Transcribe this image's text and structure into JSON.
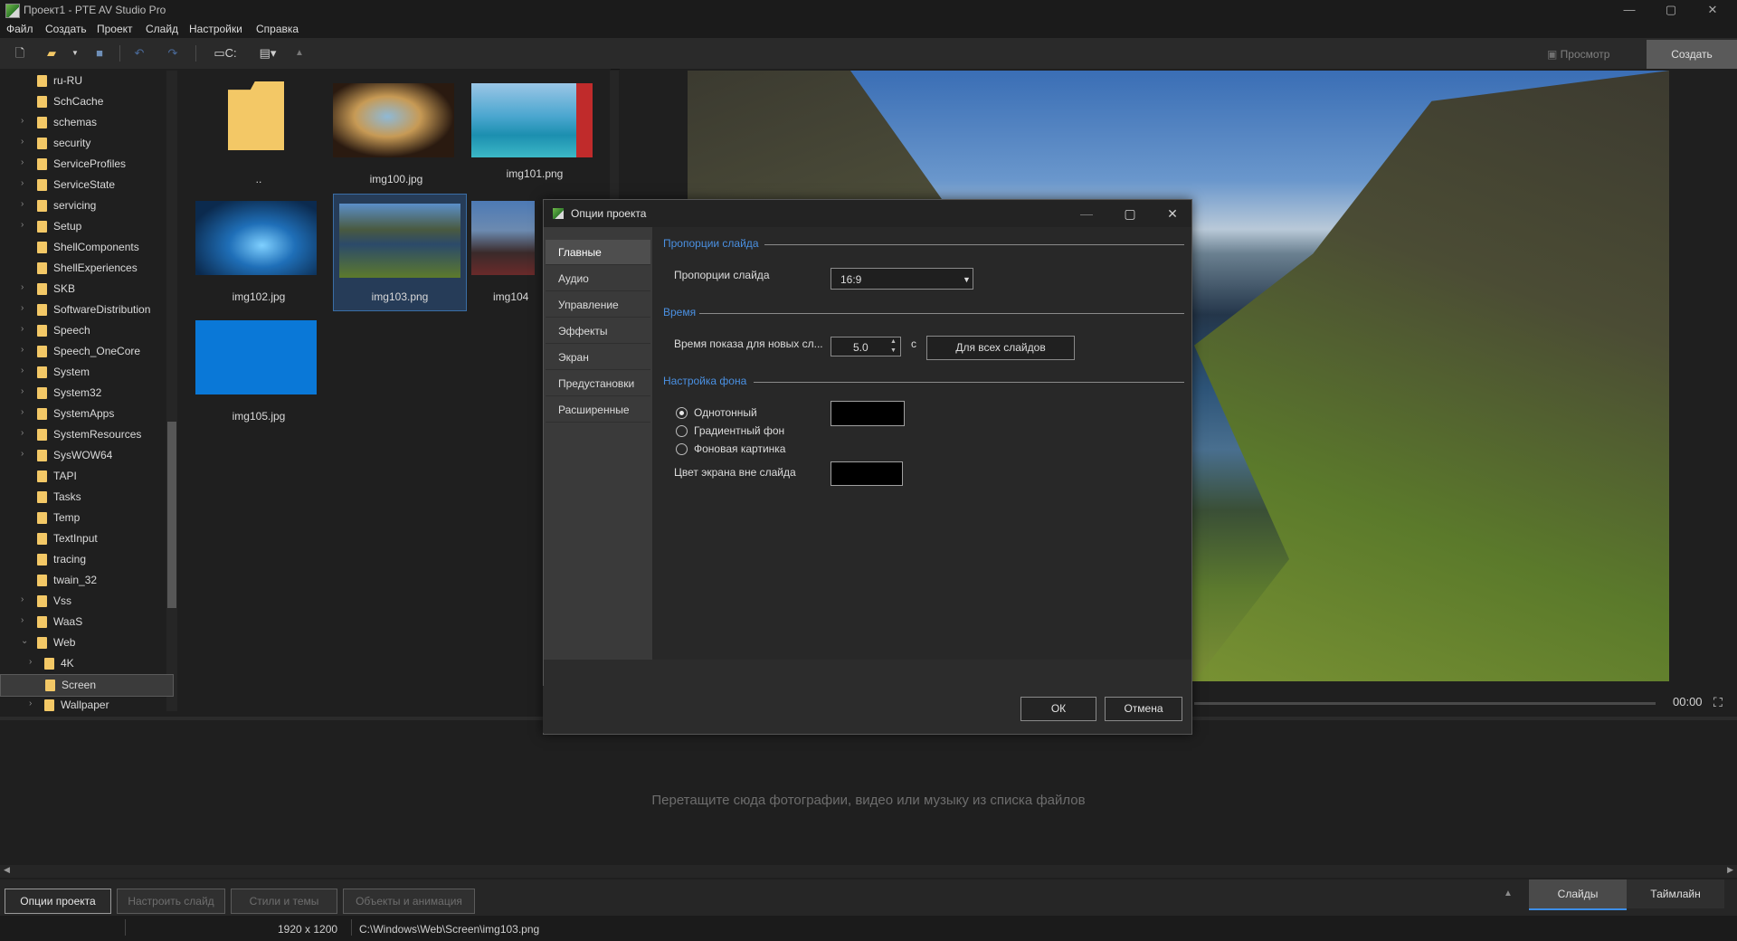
{
  "window": {
    "title": "Проект1 - PTE AV Studio Pro",
    "minimize": "—",
    "maximize": "▢",
    "close": "✕"
  },
  "menu": [
    "Файл",
    "Создать",
    "Проект",
    "Слайд",
    "Настройки",
    "Справка"
  ],
  "toolbar": {
    "drive_label": "C:",
    "preview_label": "Просмотр",
    "create_label": "Создать"
  },
  "tree": [
    {
      "label": "ru-RU",
      "arrow": ""
    },
    {
      "label": "SchCache",
      "arrow": ""
    },
    {
      "label": "schemas",
      "arrow": "›"
    },
    {
      "label": "security",
      "arrow": "›"
    },
    {
      "label": "ServiceProfiles",
      "arrow": "›"
    },
    {
      "label": "ServiceState",
      "arrow": "›"
    },
    {
      "label": "servicing",
      "arrow": "›"
    },
    {
      "label": "Setup",
      "arrow": "›"
    },
    {
      "label": "ShellComponents",
      "arrow": ""
    },
    {
      "label": "ShellExperiences",
      "arrow": ""
    },
    {
      "label": "SKB",
      "arrow": "›"
    },
    {
      "label": "SoftwareDistribution",
      "arrow": "›"
    },
    {
      "label": "Speech",
      "arrow": "›"
    },
    {
      "label": "Speech_OneCore",
      "arrow": "›"
    },
    {
      "label": "System",
      "arrow": "›"
    },
    {
      "label": "System32",
      "arrow": "›"
    },
    {
      "label": "SystemApps",
      "arrow": "›"
    },
    {
      "label": "SystemResources",
      "arrow": "›"
    },
    {
      "label": "SysWOW64",
      "arrow": "›"
    },
    {
      "label": "TAPI",
      "arrow": ""
    },
    {
      "label": "Tasks",
      "arrow": ""
    },
    {
      "label": "Temp",
      "arrow": ""
    },
    {
      "label": "TextInput",
      "arrow": ""
    },
    {
      "label": "tracing",
      "arrow": ""
    },
    {
      "label": "twain_32",
      "arrow": ""
    },
    {
      "label": "Vss",
      "arrow": "›"
    },
    {
      "label": "WaaS",
      "arrow": "›"
    },
    {
      "label": "Web",
      "arrow": "⌄"
    },
    {
      "label": "4K",
      "arrow": "›"
    },
    {
      "label": "Screen",
      "arrow": ""
    },
    {
      "label": "Wallpaper",
      "arrow": "›"
    }
  ],
  "thumbnails": [
    {
      "caption": ".."
    },
    {
      "caption": "img100.jpg"
    },
    {
      "caption": "img101.png"
    },
    {
      "caption": "img102.jpg"
    },
    {
      "caption": "img103.png"
    },
    {
      "caption": "img104"
    },
    {
      "caption": "img105.jpg"
    }
  ],
  "player": {
    "time": "00:00",
    "fullscreen": "⛶"
  },
  "storyboard": {
    "hint": "Перетащите сюда фотографии, видео или музыку из списка файлов"
  },
  "bottom_buttons": [
    "Опции проекта",
    "Настроить слайд",
    "Стили и темы",
    "Объекты и анимация"
  ],
  "bottom_tabs": {
    "slides": "Слайды",
    "timeline": "Таймлайн"
  },
  "status": {
    "resolution": "1920 x 1200",
    "path": "C:\\Windows\\Web\\Screen\\img103.png"
  },
  "dialog": {
    "title": "Опции проекта",
    "nav": [
      "Главные",
      "Аудио",
      "Управление",
      "Эффекты",
      "Экран",
      "Предустановки",
      "Расширенные"
    ],
    "sections": {
      "aspect": "Пропорции слайда",
      "time": "Время",
      "background": "Настройка фона"
    },
    "aspect_label": "Пропорции слайда",
    "aspect_value": "16:9",
    "duration_label": "Время показа для новых сл...",
    "duration_value": "5.0",
    "duration_unit": "с",
    "all_slides_button": "Для всех слайдов",
    "bg_options": [
      "Однотонный",
      "Градиентный фон",
      "Фоновая картинка"
    ],
    "outside_color_label": "Цвет экрана вне слайда",
    "ok": "ОК",
    "cancel": "Отмена"
  }
}
